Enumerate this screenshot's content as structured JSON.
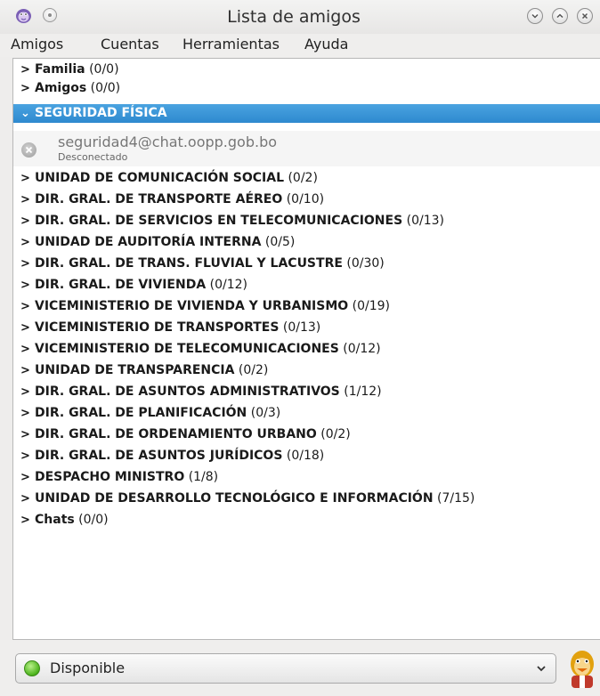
{
  "window": {
    "title": "Lista de amigos"
  },
  "menubar": {
    "items": [
      {
        "label": "Amigos"
      },
      {
        "label": "Cuentas"
      },
      {
        "label": "Herramientas"
      },
      {
        "label": "Ayuda"
      }
    ]
  },
  "groups": [
    {
      "name": "Familia",
      "count": "(0/0)",
      "expanded": false
    },
    {
      "name": "Amigos",
      "count": "(0/0)",
      "expanded": false
    },
    {
      "name": "SEGURIDAD FÍSICA",
      "count": "",
      "expanded": true
    },
    {
      "name": "UNIDAD DE COMUNICACIÓN SOCIAL",
      "count": "(0/2)",
      "expanded": false
    },
    {
      "name": "DIR. GRAL. DE TRANSPORTE AÉREO",
      "count": "(0/10)",
      "expanded": false
    },
    {
      "name": "DIR. GRAL. DE SERVICIOS EN TELECOMUNICACIONES",
      "count": "(0/13)",
      "expanded": false
    },
    {
      "name": "UNIDAD DE AUDITORÍA INTERNA",
      "count": "(0/5)",
      "expanded": false
    },
    {
      "name": "DIR. GRAL. DE TRANS. FLUVIAL Y LACUSTRE",
      "count": "(0/30)",
      "expanded": false
    },
    {
      "name": "DIR. GRAL. DE VIVIENDA",
      "count": "(0/12)",
      "expanded": false
    },
    {
      "name": "VICEMINISTERIO DE VIVIENDA Y URBANISMO",
      "count": "(0/19)",
      "expanded": false
    },
    {
      "name": "VICEMINISTERIO DE TRANSPORTES",
      "count": "(0/13)",
      "expanded": false
    },
    {
      "name": "VICEMINISTERIO DE TELECOMUNICACIONES",
      "count": "(0/12)",
      "expanded": false
    },
    {
      "name": "UNIDAD DE TRANSPARENCIA",
      "count": "(0/2)",
      "expanded": false
    },
    {
      "name": "DIR. GRAL. DE ASUNTOS ADMINISTRATIVOS",
      "count": "(1/12)",
      "expanded": false
    },
    {
      "name": "DIR. GRAL. DE PLANIFICACIÓN",
      "count": "(0/3)",
      "expanded": false
    },
    {
      "name": "DIR. GRAL. DE ORDENAMIENTO URBANO",
      "count": "(0/2)",
      "expanded": false
    },
    {
      "name": "DIR. GRAL. DE ASUNTOS JURÍDICOS",
      "count": "(0/18)",
      "expanded": false
    },
    {
      "name": "DESPACHO MINISTRO",
      "count": "(1/8)",
      "expanded": false
    },
    {
      "name": "UNIDAD DE DESARROLLO TECNOLÓGICO E INFORMACIÓN",
      "count": "(7/15)",
      "expanded": false
    },
    {
      "name": "Chats",
      "count": "(0/0)",
      "expanded": false
    }
  ],
  "buddy": {
    "name": "seguridad4@chat.oopp.gob.bo",
    "status": "Desconectado"
  },
  "status_selector": {
    "label": "Disponible"
  },
  "colors": {
    "selection": "#3a95d8",
    "available": "#4cb31c"
  }
}
